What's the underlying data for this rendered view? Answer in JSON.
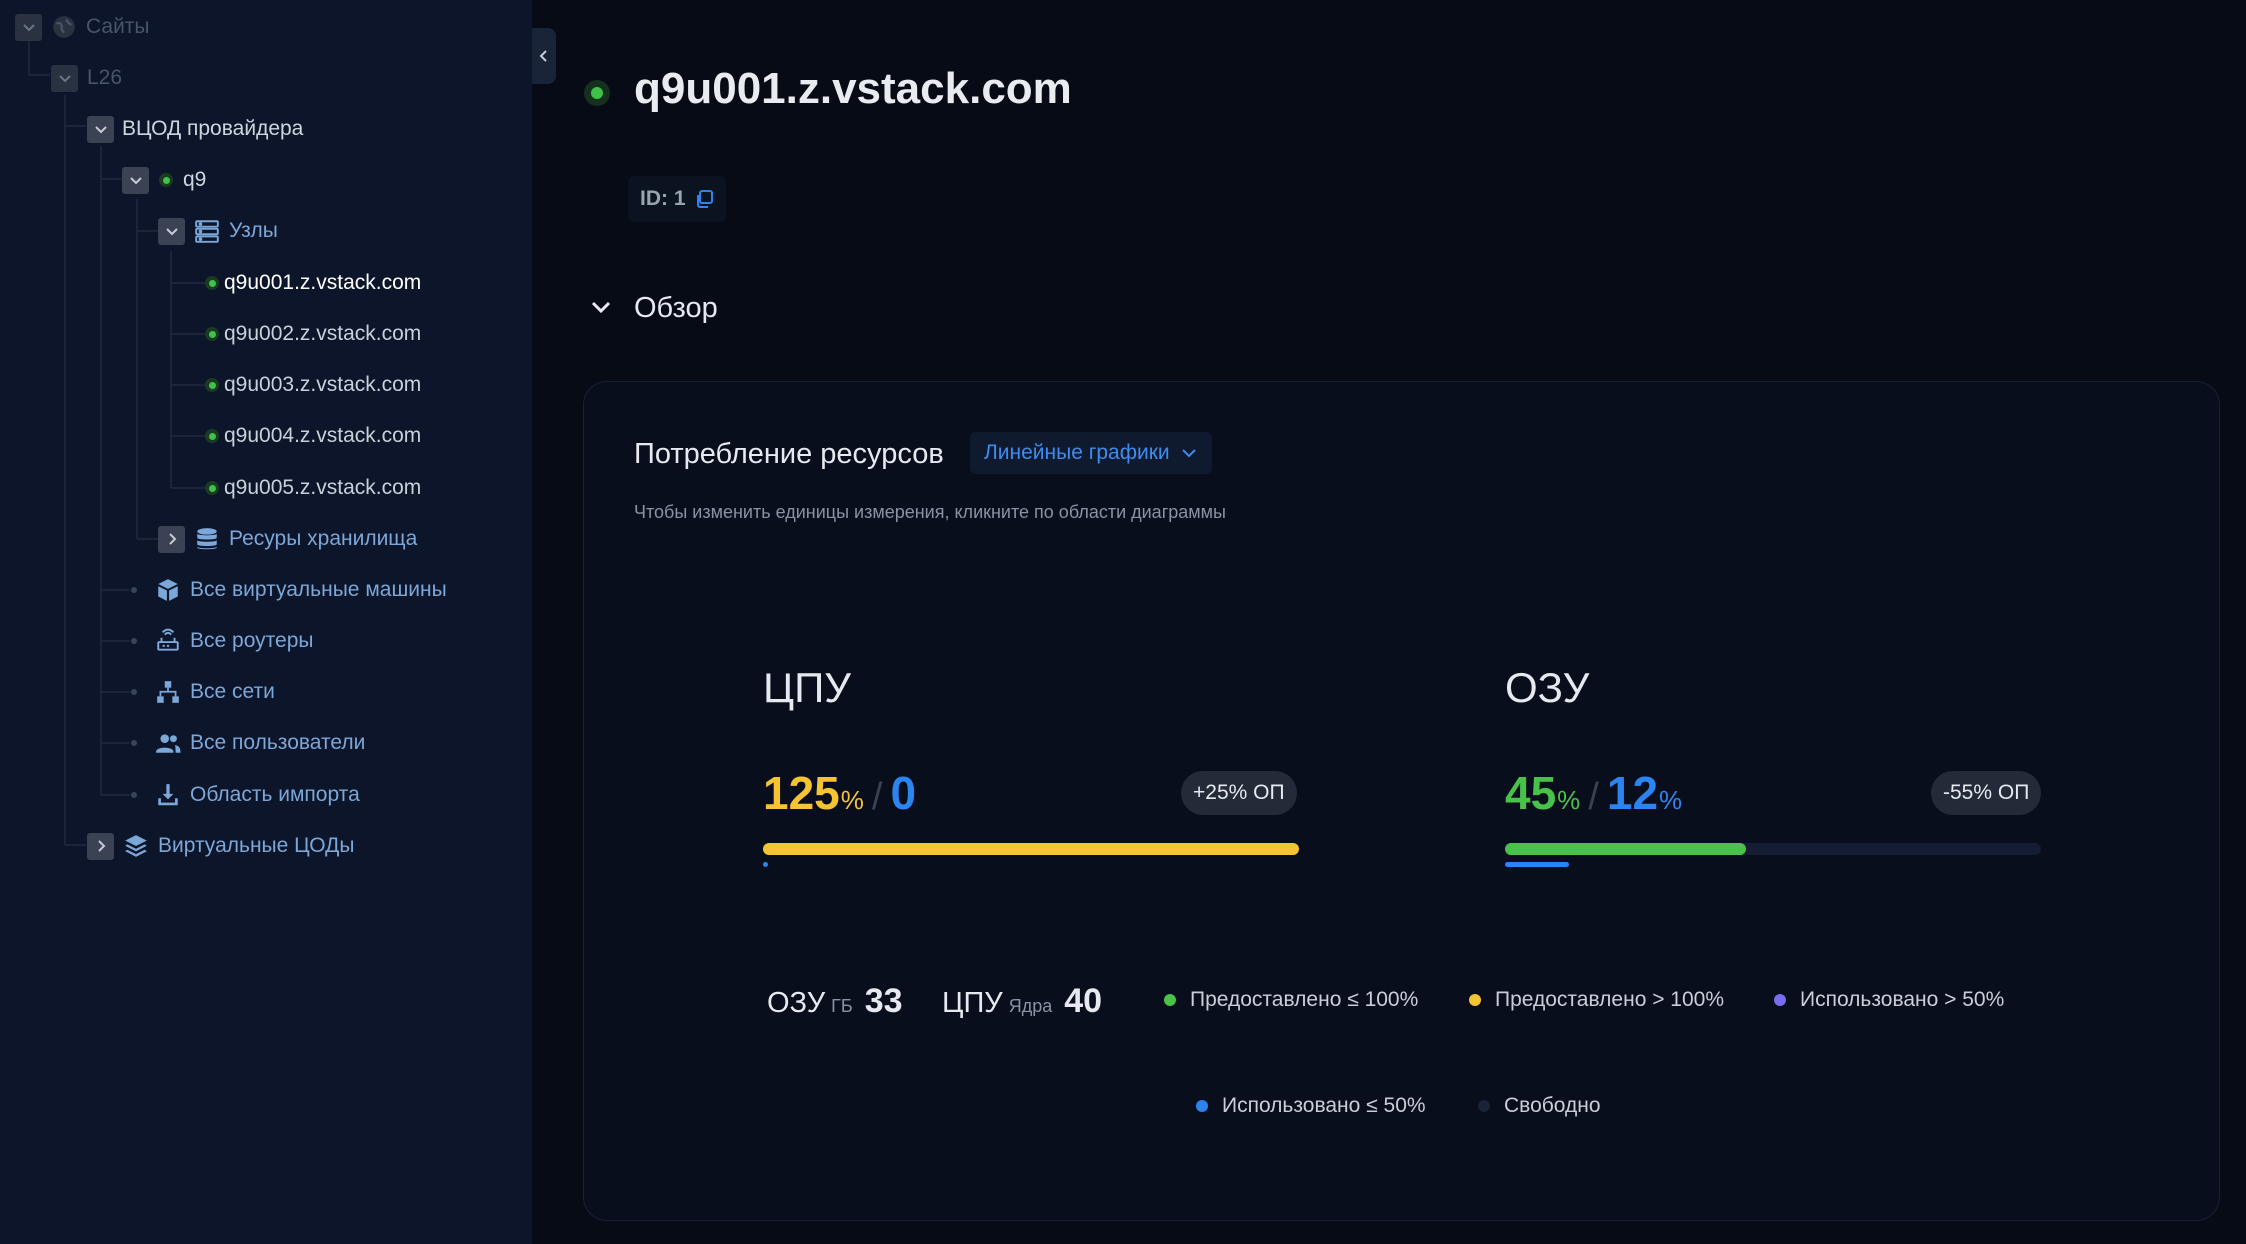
{
  "sidebar": {
    "tree": {
      "sites": "Сайты",
      "l26": "L26",
      "provider_dc": "ВЦОД провайдера",
      "cluster": "q9",
      "nodes": "Узлы",
      "node_items": [
        "q9u001.z.vstack.com",
        "q9u002.z.vstack.com",
        "q9u003.z.vstack.com",
        "q9u004.z.vstack.com",
        "q9u005.z.vstack.com"
      ],
      "storage": "Ресуры хранилища",
      "all_vms": "Все виртуальные машины",
      "all_routers": "Все роутеры",
      "all_networks": "Все сети",
      "all_users": "Все пользователи",
      "import_area": "Область импорта",
      "virtual_dcs": "Виртуальные ЦОДы"
    }
  },
  "main": {
    "title": "q9u001.z.vstack.com",
    "id_label": "ID: 1",
    "section_title": "Обзор",
    "card": {
      "title": "Потребление ресурсов",
      "chart_type": "Линейные графики",
      "hint": "Чтобы изменить единицы измерения, кликните по области диаграммы",
      "cpu": {
        "title": "ЦПУ",
        "provisioned": "125",
        "provisioned_unit": "%",
        "used": "0",
        "used_unit": "",
        "overcommit": "+25% ОП",
        "provisioned_fraction": 1.0,
        "used_fraction": 0.0
      },
      "ram": {
        "title": "ОЗУ",
        "provisioned": "45",
        "provisioned_unit": "%",
        "used": "12",
        "used_unit": "%",
        "overcommit": "-55% ОП",
        "provisioned_fraction": 0.45,
        "used_fraction": 0.12
      },
      "totals": {
        "ram_label": "ОЗУ",
        "ram_unit": "ГБ",
        "ram_value": "33",
        "cpu_label": "ЦПУ",
        "cpu_unit": "Ядра",
        "cpu_value": "40"
      },
      "legend": [
        {
          "label": "Предоставлено ≤ 100%",
          "color": "#49c24a"
        },
        {
          "label": "Предоставлено > 100%",
          "color": "#f6c431"
        },
        {
          "label": "Использовано > 50%",
          "color": "#7a6cf0"
        },
        {
          "label": "Использовано ≤ 50%",
          "color": "#2b84f0"
        },
        {
          "label": "Свободно",
          "color": "#1a2236"
        }
      ]
    }
  },
  "colors": {
    "sidebar_bg": "#0c1529",
    "page_bg": "#060b16",
    "status_ok": "#3ec24a",
    "accent_blue": "#2b84f0",
    "warning_yellow": "#f6c431"
  }
}
